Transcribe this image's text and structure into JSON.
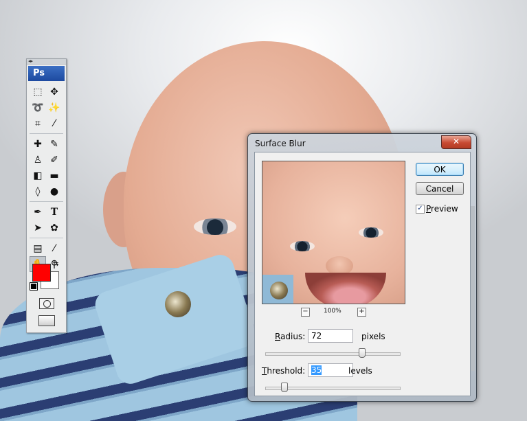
{
  "toolbox": {
    "logo": "Ps",
    "tools": [
      [
        "marquee-icon",
        "move-icon"
      ],
      [
        "lasso-icon",
        "magic-wand-icon"
      ],
      [
        "crop-icon",
        "eyedropper-icon"
      ],
      [
        "healing-brush-icon",
        "brush-icon"
      ],
      [
        "clone-stamp-icon",
        "history-brush-icon"
      ],
      [
        "eraser-icon",
        "gradient-icon"
      ],
      [
        "blur-icon",
        "dodge-icon"
      ],
      [
        "pen-icon",
        "type-icon"
      ],
      [
        "path-selection-icon",
        "custom-shape-icon"
      ],
      [
        "notes-icon",
        "eyedropper-icon"
      ],
      [
        "hand-icon",
        "zoom-icon"
      ]
    ],
    "tool_glyphs": [
      [
        "⬚",
        "✥"
      ],
      [
        "ⴰ",
        "⁂"
      ],
      [
        "⌗",
        "⁄"
      ],
      [
        "✎",
        "⁄"
      ],
      [
        "♙",
        "⁄"
      ],
      [
        "◧",
        "■"
      ],
      [
        "💧",
        "●"
      ],
      [
        "✒",
        "T"
      ],
      [
        "➤",
        "✿"
      ],
      [
        "▤",
        "⁄"
      ],
      [
        "✋",
        "🔍"
      ]
    ],
    "foreground_color": "#ff0000",
    "background_color": "#ffffff"
  },
  "dialog": {
    "title": "Surface Blur",
    "close_glyph": "✕",
    "zoom_level": "100%",
    "zoom_out_glyph": "−",
    "zoom_in_glyph": "+",
    "ok_label": "OK",
    "cancel_label": "Cancel",
    "preview_label_first": "P",
    "preview_label_rest": "review",
    "preview_checked": true,
    "check_glyph": "✓",
    "radius": {
      "label_first": "R",
      "label_rest": "adius:",
      "value": "72",
      "unit": "pixels",
      "fraction": 0.72
    },
    "threshold": {
      "label_first": "T",
      "label_rest": "hreshold:",
      "value": "35",
      "unit": "levels",
      "fraction": 0.14
    }
  }
}
